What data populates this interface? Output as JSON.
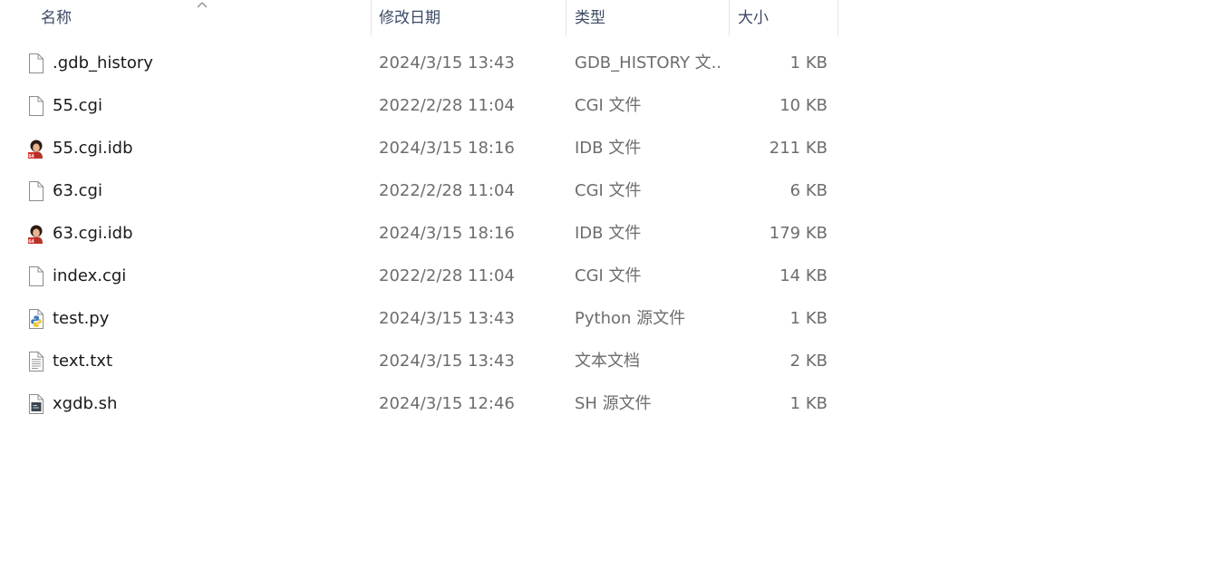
{
  "columns": {
    "name": "名称",
    "date": "修改日期",
    "type": "类型",
    "size": "大小"
  },
  "sort": {
    "column": "name",
    "direction": "ascending",
    "icon": "sort-up-chevron"
  },
  "files": [
    {
      "icon": "blank-file-icon",
      "name": ".gdb_history",
      "date": "2024/3/15 13:43",
      "type": "GDB_HISTORY 文...",
      "size": "1 KB"
    },
    {
      "icon": "blank-file-icon",
      "name": "55.cgi",
      "date": "2022/2/28 11:04",
      "type": "CGI 文件",
      "size": "10 KB"
    },
    {
      "icon": "ida-database-icon",
      "name": "55.cgi.idb",
      "date": "2024/3/15 18:16",
      "type": "IDB 文件",
      "size": "211 KB"
    },
    {
      "icon": "blank-file-icon",
      "name": "63.cgi",
      "date": "2022/2/28 11:04",
      "type": "CGI 文件",
      "size": "6 KB"
    },
    {
      "icon": "ida-database-icon",
      "name": "63.cgi.idb",
      "date": "2024/3/15 18:16",
      "type": "IDB 文件",
      "size": "179 KB"
    },
    {
      "icon": "blank-file-icon",
      "name": "index.cgi",
      "date": "2022/2/28 11:04",
      "type": "CGI 文件",
      "size": "14 KB"
    },
    {
      "icon": "python-file-icon",
      "name": "test.py",
      "date": "2024/3/15 13:43",
      "type": "Python 源文件",
      "size": "1 KB"
    },
    {
      "icon": "text-file-icon",
      "name": "text.txt",
      "date": "2024/3/15 13:43",
      "type": "文本文档",
      "size": "2 KB"
    },
    {
      "icon": "shell-script-icon",
      "name": "xgdb.sh",
      "date": "2024/3/15 12:46",
      "type": "SH 源文件",
      "size": "1 KB"
    }
  ],
  "colors": {
    "header_text": "#3b4a63",
    "name_text": "#1a1a1a",
    "detail_text": "#6d6d6d",
    "divider": "#e5e5e5"
  }
}
